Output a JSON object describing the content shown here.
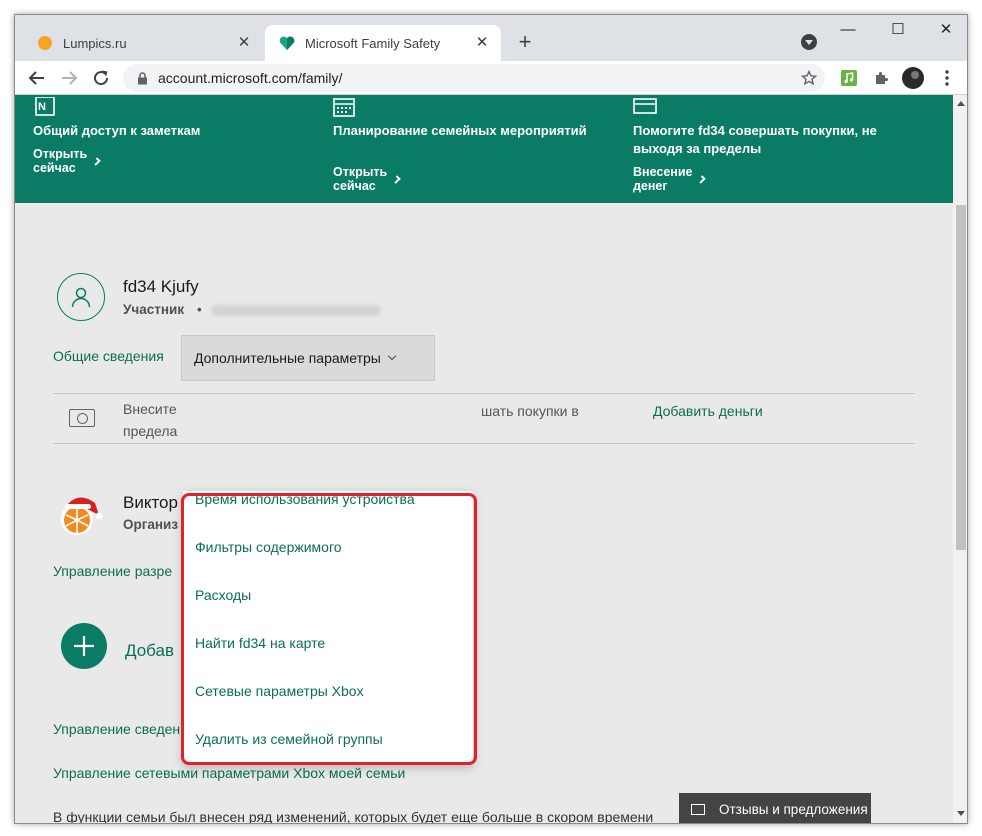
{
  "browser": {
    "tabs": [
      {
        "label": "Lumpics.ru",
        "active": false
      },
      {
        "label": "Microsoft Family Safety",
        "active": true
      }
    ],
    "url": "account.microsoft.com/family/",
    "window_controls": [
      "minimize",
      "maximize",
      "close"
    ]
  },
  "banner": {
    "items": [
      {
        "title": "Общий доступ к заметкам",
        "link": "Открыть сейчас",
        "icon": "onenote-icon"
      },
      {
        "title": "Планирование семейных мероприятий",
        "link": "Открыть сейчас",
        "icon": "calendar-icon"
      },
      {
        "title": "Помогите fd34 совершать покупки, не выходя за пределы",
        "link": "Внесение денег",
        "icon": "card-icon"
      }
    ],
    "color": "#0a7b64"
  },
  "member": {
    "name": "fd34 Kjufy",
    "role": "Участник",
    "separator": "•"
  },
  "member_tabs": {
    "overview": "Общие сведения",
    "more": "Дополнительные параметры"
  },
  "money": {
    "text_start": "Внесите",
    "text_line2": "предела",
    "text_end": "шать покупки в",
    "add_money": "Добавить деньги"
  },
  "organizer": {
    "name": "Виктор",
    "role": "Организ",
    "manage_permissions": "Управление разре"
  },
  "add_member": {
    "label": "Добав"
  },
  "links": {
    "child_profile": "Управление сведениями детского профиля",
    "xbox_family": "Управление сетевыми параметрами Xbox моей семьи"
  },
  "notice": "В функции семьи был внесен ряд изменений, которых будет еще больше в скором времени",
  "feedback": "Отзывы и предложения",
  "dropdown_menu": {
    "items": [
      "Время использования устройства",
      "Фильтры содержимого",
      "Расходы",
      "Найти fd34 на карте",
      "Сетевые параметры Xbox",
      "Удалить из семейной группы"
    ]
  },
  "colors": {
    "accent": "#0a7b64",
    "highlight": "#e3212a",
    "link": "#0a6e55"
  }
}
